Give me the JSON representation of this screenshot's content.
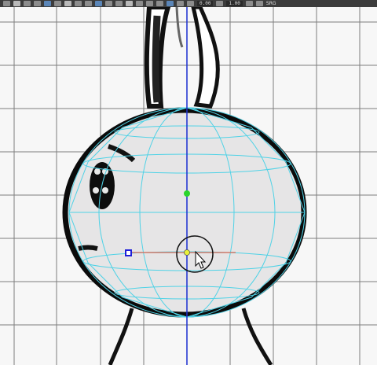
{
  "toolbar": {
    "field_1_value": "0.00",
    "field_2_value": "1.00",
    "right_label": "SRG"
  },
  "colors": {
    "toolbar_bg": "#3c3c3c",
    "grid": "#555555",
    "wireframe": "#4fd2e6",
    "axis_vertical": "#1a2fd0",
    "axis_horizontal": "#d07a6a",
    "pivot_green": "#2ad52a",
    "pivot_yellow": "#e8f23a",
    "blue_handle": "#1f1fd8"
  },
  "icons": [
    "toolbar-tool-icon",
    "move-icon",
    "rotate-icon",
    "scale-icon",
    "snap-icon",
    "render-icon",
    "camera-icon",
    "settings-icon"
  ]
}
